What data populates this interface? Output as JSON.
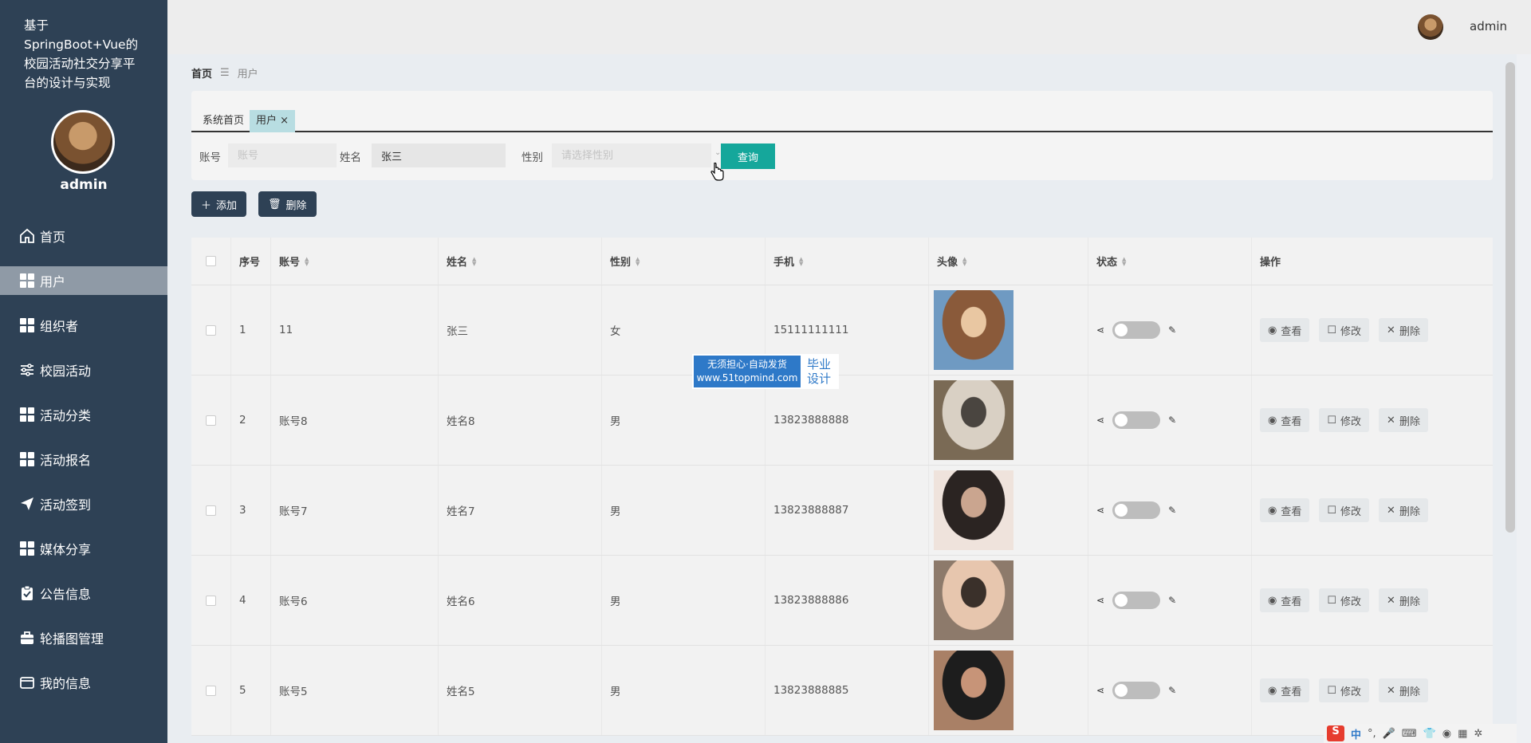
{
  "app": {
    "title": "基于SpringBoot+Vue的校园活动社交分享平台的设计与实现",
    "username": "admin"
  },
  "sidebar": {
    "items": [
      {
        "label": "首页",
        "icon": "home-icon"
      },
      {
        "label": "用户",
        "icon": "grid-icon"
      },
      {
        "label": "组织者",
        "icon": "grid-icon"
      },
      {
        "label": "校园活动",
        "icon": "sliders-icon"
      },
      {
        "label": "活动分类",
        "icon": "grid-icon"
      },
      {
        "label": "活动报名",
        "icon": "grid-icon"
      },
      {
        "label": "活动签到",
        "icon": "send-icon"
      },
      {
        "label": "媒体分享",
        "icon": "grid-icon"
      },
      {
        "label": "公告信息",
        "icon": "clipboard-icon"
      },
      {
        "label": "轮播图管理",
        "icon": "briefcase-icon"
      },
      {
        "label": "我的信息",
        "icon": "card-icon"
      }
    ],
    "active": "用户"
  },
  "topbar": {
    "username": "admin"
  },
  "breadcrumb": {
    "home": "首页",
    "sep": "☰",
    "current": "用户"
  },
  "tabs": [
    {
      "label": "系统首页"
    },
    {
      "label": "用户",
      "close": "×"
    }
  ],
  "search": {
    "account_label": "账号",
    "account_placeholder": "账号",
    "name_label": "姓名",
    "name_value": "张三",
    "gender_label": "性别",
    "gender_placeholder": "请选择性别",
    "query_button": "查询"
  },
  "actions": {
    "add": "添加",
    "delete": "删除"
  },
  "table": {
    "headers": [
      "序号",
      "账号",
      "姓名",
      "性别",
      "手机",
      "头像",
      "状态",
      "操作"
    ],
    "rows": [
      {
        "index": "1",
        "account": "11",
        "name": "张三",
        "gender": "女",
        "phone": "15111111111",
        "photo_colors": [
          "#e9c7a2",
          "#8a5a3a",
          "#6f9ac2"
        ]
      },
      {
        "index": "2",
        "account": "账号8",
        "name": "姓名8",
        "gender": "男",
        "phone": "13823888888",
        "photo_colors": [
          "#4a4540",
          "#d9d0c4",
          "#7a6a55"
        ]
      },
      {
        "index": "3",
        "account": "账号7",
        "name": "姓名7",
        "gender": "男",
        "phone": "13823888887",
        "photo_colors": [
          "#caa58f",
          "#2b2422",
          "#efe3dc"
        ]
      },
      {
        "index": "4",
        "account": "账号6",
        "name": "姓名6",
        "gender": "男",
        "phone": "13823888886",
        "photo_colors": [
          "#3a302a",
          "#e7c6ae",
          "#8d7a6b"
        ]
      },
      {
        "index": "5",
        "account": "账号5",
        "name": "姓名5",
        "gender": "男",
        "phone": "13823888885",
        "photo_colors": [
          "#c79478",
          "#1d1d1d",
          "#a98066"
        ]
      }
    ],
    "row_actions": {
      "view": "查看",
      "edit": "修改",
      "delete": "删除"
    }
  },
  "watermark": {
    "line1": "无须担心·自动发货",
    "line2": "www.51topmind.com",
    "side1": "毕业",
    "side2": "设计"
  },
  "ime": {
    "brand": "S",
    "mode": "中"
  }
}
